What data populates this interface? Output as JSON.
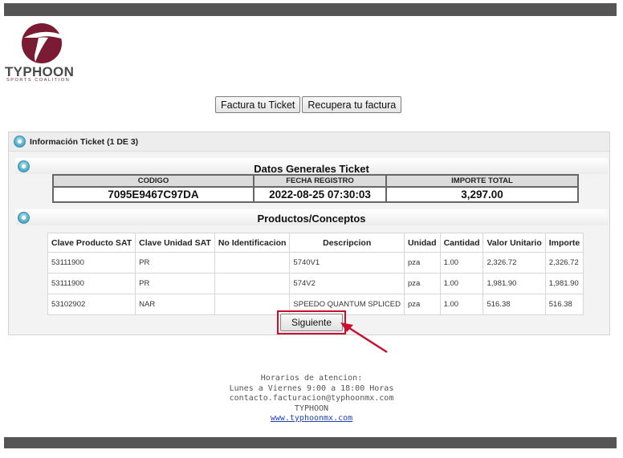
{
  "brand": {
    "name": "TYPHOON",
    "subtitle": "SPORTS COALITION",
    "primary_color": "#7a1b33",
    "logo_icon": "typhoon-logo-icon"
  },
  "nav": {
    "invoice_ticket_label": "Factura tu Ticket",
    "recover_invoice_label": "Recupera tu factura"
  },
  "panel": {
    "title": "Información Ticket (1 DE 3)",
    "section_general": {
      "title": "Datos Generales Ticket",
      "headers": [
        "CODIGO",
        "FECHA REGISTRO",
        "IMPORTE TOTAL"
      ],
      "values": [
        "7095E9467C97DA",
        "2022-08-25 07:30:03",
        "3,297.00"
      ]
    },
    "section_products": {
      "title": "Productos/Conceptos",
      "headers": [
        "Clave Producto SAT",
        "Clave Unidad SAT",
        "No Identificacion",
        "Descripcion",
        "Unidad",
        "Cantidad",
        "Valor Unitario",
        "Importe"
      ],
      "rows": [
        [
          "53111900",
          "PR",
          "",
          "5740V1",
          "pza",
          "1.00",
          "2,326.72",
          "2,326.72"
        ],
        [
          "53111900",
          "PR",
          "",
          "574V2",
          "pza",
          "1.00",
          "1,981.90",
          "1,981.90"
        ],
        [
          "53102902",
          "NAR",
          "",
          "SPEEDO QUANTUM SPLICED",
          "pza",
          "1.00",
          "516.38",
          "516.38"
        ]
      ]
    },
    "next_label": "Siguiente",
    "highlight_color": "#c8102e"
  },
  "footer": {
    "hours_title": "Horarios de atencion:",
    "hours": "Lunes a Viernes 9:00 a 18:00 Horas",
    "email": "contacto.facturacion@typhoonmx.com",
    "company": "TYPHOON",
    "website": "www.typhoonmx.com"
  }
}
